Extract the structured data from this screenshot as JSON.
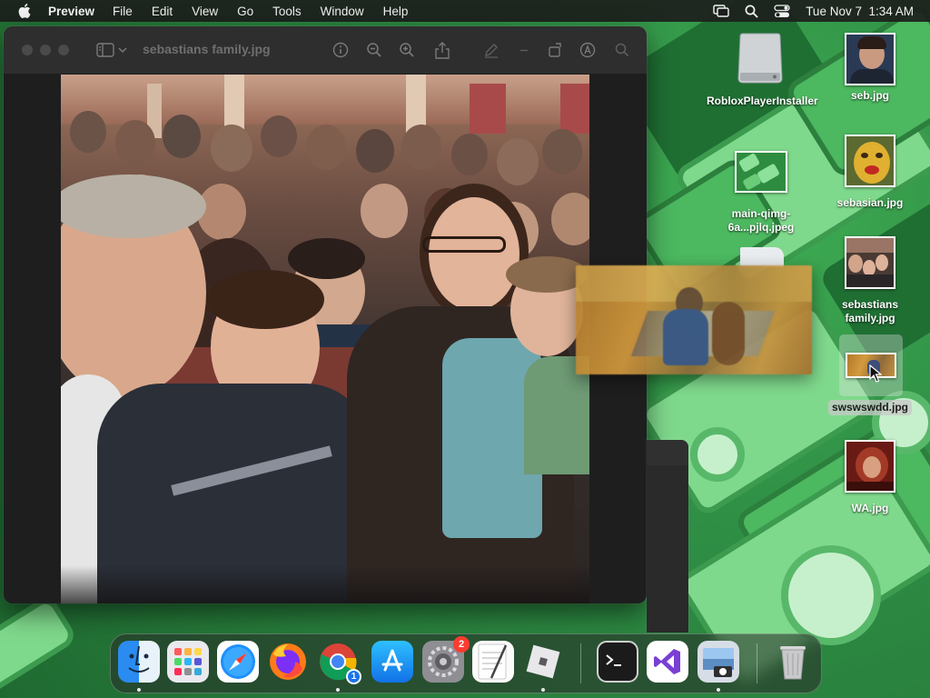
{
  "menubar": {
    "app_name": "Preview",
    "menus": [
      "File",
      "Edit",
      "View",
      "Go",
      "Tools",
      "Window",
      "Help"
    ],
    "clock": "Tue Nov 7  1:34 AM",
    "status_icons": [
      "screen-mirroring-icon",
      "spotlight-search-icon",
      "control-center-icon"
    ]
  },
  "preview_window": {
    "title": "sebastians family.jpg",
    "toolbar_icons": [
      "sidebar-toggle-icon",
      "chevron-down-icon",
      "info-icon",
      "zoom-out-icon",
      "zoom-in-icon",
      "share-icon",
      "markup-pen-icon",
      "rotate-icon",
      "annotate-icon",
      "search-icon"
    ]
  },
  "desktop": {
    "icons_left_column": [
      {
        "label": "RobloxPlayerInstaller",
        "icon": "disk-image-icon"
      },
      {
        "label": "main-qimg-6a...pjlq.jpeg",
        "icon": "image-thumbnail"
      },
      {
        "label": "",
        "icon": "document-icon"
      }
    ],
    "icons_right_column": [
      {
        "label": "seb.jpg",
        "icon": "image-thumbnail"
      },
      {
        "label": "sebasian.jpg",
        "icon": "image-thumbnail"
      },
      {
        "label": "sebastians family.jpg",
        "icon": "image-thumbnail"
      },
      {
        "label": "swswswdd.jpg",
        "icon": "image-thumbnail",
        "selected": true
      },
      {
        "label": "WA.jpg",
        "icon": "image-thumbnail"
      }
    ]
  },
  "dock": {
    "apps": [
      {
        "name": "Finder",
        "icon": "finder-icon",
        "running": true
      },
      {
        "name": "Launchpad",
        "icon": "launchpad-icon",
        "running": false
      },
      {
        "name": "Safari",
        "icon": "safari-icon",
        "running": false
      },
      {
        "name": "Firefox",
        "icon": "firefox-icon",
        "running": false
      },
      {
        "name": "Google Chrome",
        "icon": "chrome-icon",
        "running": true,
        "mini_badge": "1"
      },
      {
        "name": "App Store",
        "icon": "app-store-icon",
        "running": false
      },
      {
        "name": "System Settings",
        "icon": "system-settings-icon",
        "running": false,
        "badge": "2"
      },
      {
        "name": "TextEdit",
        "icon": "textedit-icon",
        "running": false
      },
      {
        "name": "Roblox",
        "icon": "roblox-icon",
        "running": true
      },
      {
        "name": "Terminal",
        "icon": "terminal-icon",
        "running": false
      },
      {
        "name": "Visual Studio",
        "icon": "visual-studio-icon",
        "running": false
      },
      {
        "name": "Preview",
        "icon": "preview-icon",
        "running": true
      },
      {
        "name": "Trash",
        "icon": "trash-icon",
        "running": false
      }
    ]
  },
  "colors": {
    "menubar_bg": "#1c1e1c",
    "wallpaper_green": "#2f8f45",
    "badge_red": "#ff3b30"
  }
}
